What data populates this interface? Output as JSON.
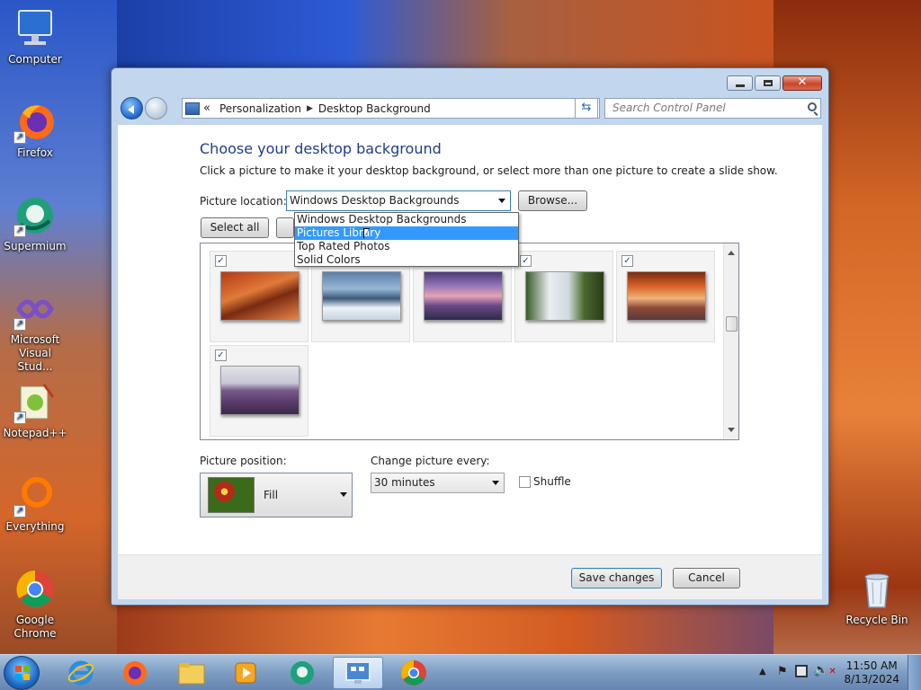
{
  "desktop": {
    "icons": [
      {
        "label": "Computer",
        "icon": "computer-icon"
      },
      {
        "label": "Firefox",
        "icon": "firefox-icon"
      },
      {
        "label": "Supermium",
        "icon": "supermium-icon"
      },
      {
        "label": "Microsoft Visual Stud...",
        "icon": "visual-studio-icon"
      },
      {
        "label": "Notepad++",
        "icon": "notepadpp-icon"
      },
      {
        "label": "Everything",
        "icon": "everything-icon"
      },
      {
        "label": "Google Chrome",
        "icon": "chrome-icon"
      },
      {
        "label": "Recycle Bin",
        "icon": "recycle-bin-icon"
      }
    ]
  },
  "window": {
    "breadcrumb": {
      "chevron": "«",
      "items": [
        "Personalization",
        "Desktop Background"
      ]
    },
    "search_placeholder": "Search Control Panel",
    "heading": "Choose your desktop background",
    "description": "Click a picture to make it your desktop background, or select more than one picture to create a slide show.",
    "picture_location": {
      "label": "Picture location:",
      "value": "Windows Desktop Backgrounds",
      "options": [
        "Windows Desktop Backgrounds",
        "Pictures Library",
        "Top Rated Photos",
        "Solid Colors"
      ],
      "highlighted": "Pictures Library"
    },
    "browse_label": "Browse...",
    "select_all_label": "Select all",
    "thumbnails": [
      {
        "checked": true,
        "subject": "canyon"
      },
      {
        "checked": true,
        "subject": "lake-snow"
      },
      {
        "checked": true,
        "subject": "sunset-coast"
      },
      {
        "checked": true,
        "subject": "waterfall"
      },
      {
        "checked": true,
        "subject": "rock-arch"
      },
      {
        "checked": true,
        "subject": "lavender-field"
      }
    ],
    "picture_position": {
      "label": "Picture position:",
      "value": "Fill"
    },
    "change_picture": {
      "label": "Change picture every:",
      "value": "30 minutes"
    },
    "shuffle": {
      "label": "Shuffle",
      "checked": false
    },
    "save_label": "Save changes",
    "cancel_label": "Cancel"
  },
  "taskbar": {
    "apps": [
      "internet-explorer-icon",
      "firefox-icon",
      "file-explorer-icon",
      "media-player-icon",
      "supermium-icon",
      "control-panel-icon",
      "chrome-icon"
    ],
    "active_app": "control-panel-icon",
    "time": "11:50 AM",
    "date": "8/13/2024"
  },
  "colors": {
    "heading": "#1e3d8c",
    "selection": "#3399ff"
  }
}
